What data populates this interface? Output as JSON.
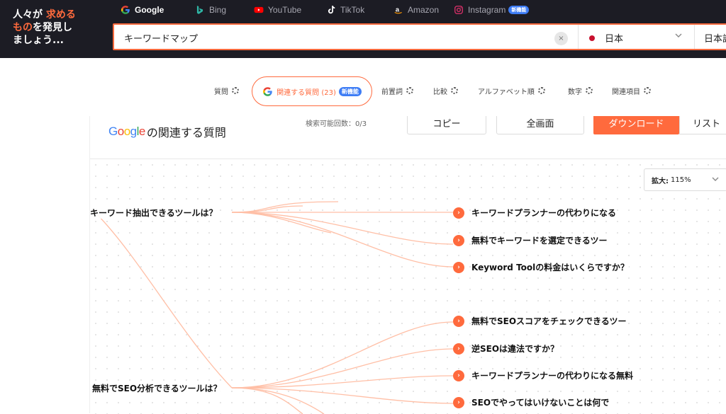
{
  "logo": {
    "line1_a": "人々が",
    "line1_b": "求める",
    "line2_a": "もの",
    "line2_b": "を発見し",
    "line3": "ましょう..."
  },
  "engines": [
    {
      "label": "Google",
      "icon": "google-icon",
      "active": true
    },
    {
      "label": "Bing",
      "icon": "bing-icon"
    },
    {
      "label": "YouTube",
      "icon": "youtube-icon"
    },
    {
      "label": "TikTok",
      "icon": "tiktok-icon"
    },
    {
      "label": "Amazon",
      "icon": "amazon-icon"
    },
    {
      "label": "Instagram",
      "icon": "instagram-icon",
      "badge": "新機能"
    }
  ],
  "search": {
    "value": "キーワードマップ",
    "clear": "×",
    "country": "日本",
    "language": "日本語"
  },
  "filters": {
    "questions": "質問",
    "related": "関連する質問 (23)",
    "related_badge": "新機能",
    "prepositions": "前置詞",
    "comparisons": "比較",
    "alphabetical": "アルファベット順",
    "numbers": "数字",
    "related_terms": "関連項目"
  },
  "card": {
    "title_google": "Google",
    "title_suffix": "の関連する質問",
    "search_volume_cut": "検索可能回数：0/3",
    "btn_copy": "コピー",
    "btn_download": "全画面",
    "btn_orange": "ダウンロード",
    "btn_list": "リスト"
  },
  "zoom": {
    "label": "拡大:",
    "value": "115%"
  },
  "mindmap": {
    "root_nodes": [
      "キーワード抽出できるツールは？",
      "無料でSEO分析できるツールは？"
    ],
    "leaves": [
      "キーワードプランナーの代わりになる",
      "無料でキーワードを選定できるツー",
      "Keyword Toolの料金はいくらですか？",
      "無料でSEOスコアをチェックできるツー",
      "逆SEOは違法ですか？",
      "キーワードプランナーの代わりになる無料",
      "SEOでやってはいけないことは何で"
    ]
  },
  "colors": {
    "accent": "#ff6a3d",
    "topbar": "#1c1c24",
    "line": "#ffbfa6",
    "badge": "#3d7cf5"
  }
}
